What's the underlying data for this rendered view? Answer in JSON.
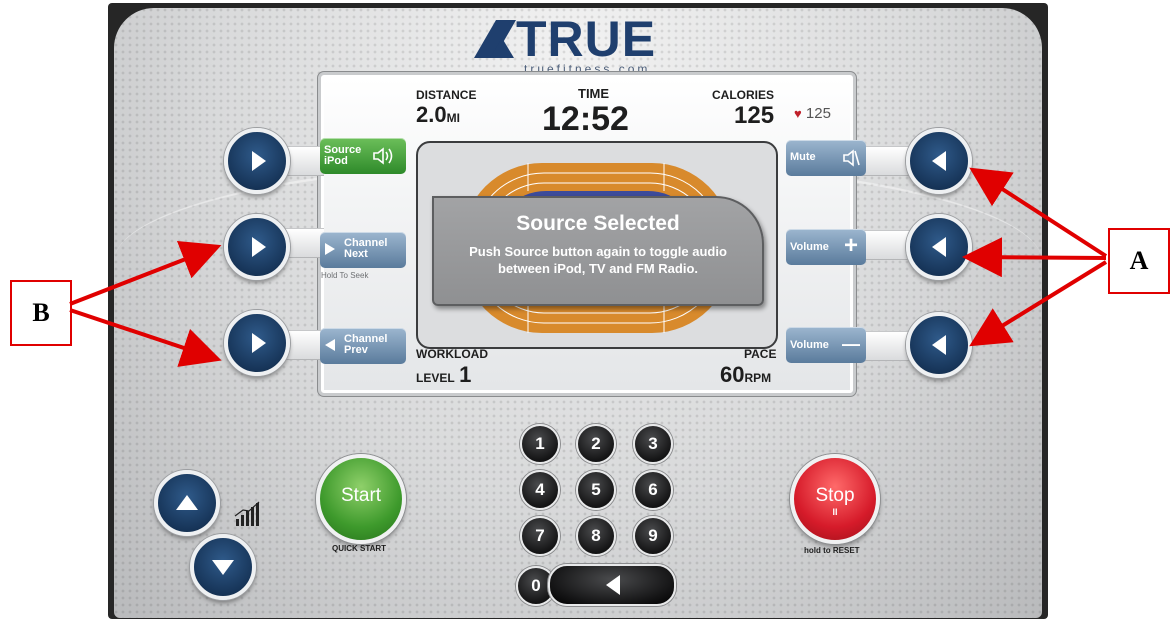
{
  "brand": {
    "name": "TRUE",
    "url": "truefitness.com"
  },
  "screen": {
    "distance": {
      "label": "DISTANCE",
      "value": "2.0",
      "unit": "MI"
    },
    "time": {
      "label": "TIME",
      "value": "12:52"
    },
    "calories": {
      "label": "CALORIES",
      "value": "125"
    },
    "heart_rate": {
      "icon": "heart-icon",
      "value": "125"
    },
    "workload": {
      "label": "WORKLOAD",
      "prefix": "LEVEL",
      "value": "1"
    },
    "pace": {
      "label": "PACE",
      "value": "60",
      "unit": "RPM"
    }
  },
  "dialog": {
    "title": "Source Selected",
    "body_line1": "Push Source button again to toggle audio",
    "body_line2": "between iPod, TV and FM Radio."
  },
  "left_keys": [
    {
      "line1": "Source",
      "line2": "iPod",
      "icon": "speaker-icon"
    },
    {
      "line1": "Channel",
      "line2": "Next",
      "hint": "Hold To Seek"
    },
    {
      "line1": "Channel",
      "line2": "Prev"
    }
  ],
  "right_keys": [
    {
      "label": "Mute",
      "icon": "mute-icon"
    },
    {
      "label": "Volume",
      "symbol": "+"
    },
    {
      "label": "Volume",
      "symbol": "—"
    }
  ],
  "controls": {
    "start": {
      "label": "Start",
      "caption": "QUICK START"
    },
    "stop": {
      "label": "Stop",
      "pause_glyph": "II",
      "caption": "hold to RESET"
    },
    "keypad": [
      "1",
      "2",
      "3",
      "4",
      "5",
      "6",
      "7",
      "8",
      "9",
      "0"
    ]
  },
  "annotations": {
    "a": "A",
    "b": "B"
  },
  "colors": {
    "arrow": "#e00000",
    "button_blue": "#173559",
    "start_green": "#3e9a2c",
    "stop_red": "#d61b2a"
  }
}
